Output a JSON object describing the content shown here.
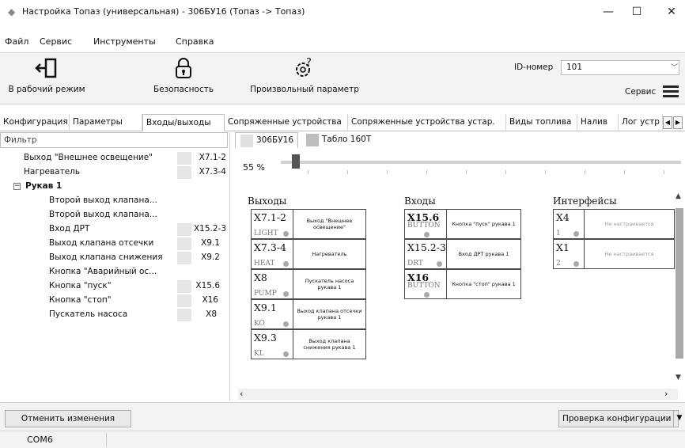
{
  "window": {
    "title": "Настройка Топаз (универсальная) - 306БУ16 (Топаз -> Топаз)",
    "minimize": "—",
    "maximize": "☐",
    "close": "✕"
  },
  "menu": [
    "Файл",
    "Сервис",
    "Инструменты",
    "Справка"
  ],
  "toolbar": {
    "work_mode": "В рабочий режим",
    "security": "Безопасность",
    "arbitrary_param": "Произвольный параметр",
    "id_label": "ID-номер",
    "id_value": "101",
    "service": "Сервис"
  },
  "main_tabs": [
    "Конфигурация",
    "Параметры",
    "Входы/выходы",
    "Сопряженные устройства",
    "Сопряженные устройства устар.",
    "Виды топлива",
    "Налив",
    "Лог устр"
  ],
  "active_main_tab": "Входы/выходы",
  "left_panel": {
    "filter_placeholder": "Фильтр",
    "items": [
      {
        "label": "Выход \"Внешнее освещение\"",
        "pin": "X7.1-2",
        "level": 1
      },
      {
        "label": "Нагреватель",
        "pin": "X7.3-4",
        "level": 1
      },
      {
        "label": "Рукав 1",
        "pin": "",
        "level": 0,
        "group": true
      },
      {
        "label": "Второй выход клапана...",
        "pin": "",
        "level": 2
      },
      {
        "label": "Второй выход клапана...",
        "pin": "",
        "level": 2
      },
      {
        "label": "Вход ДРТ",
        "pin": "X15.2-3",
        "level": 2
      },
      {
        "label": "Выход клапана отсечки",
        "pin": "X9.1",
        "level": 2
      },
      {
        "label": "Выход клапана снижения",
        "pin": "X9.2",
        "level": 2
      },
      {
        "label": "Кнопка \"Аварийный ос...",
        "pin": "",
        "level": 2
      },
      {
        "label": "Кнопка \"пуск\"",
        "pin": "X15.6",
        "level": 2
      },
      {
        "label": "Кнопка \"стоп\"",
        "pin": "X16",
        "level": 2
      },
      {
        "label": "Пускатель насоса",
        "pin": "X8",
        "level": 2
      }
    ]
  },
  "sub_tabs": [
    "306БУ16",
    "Табло 160Т"
  ],
  "zoom": {
    "label": "55 %",
    "value": 55
  },
  "diagram": {
    "outputs_title": "Выходы",
    "inputs_title": "Входы",
    "interfaces_title": "Интерфейсы",
    "outputs": [
      {
        "code": "X7.1-2",
        "sub": "LIGHT",
        "desc": "Выход \"Внешнее освещение\""
      },
      {
        "code": "X7.3-4",
        "sub": "HEAT",
        "desc": "Нагреватель"
      },
      {
        "code": "X8",
        "sub": "PUMP",
        "desc": "Пускатель насоса рукава 1"
      },
      {
        "code": "X9.1",
        "sub": "KO",
        "desc": "Выход клапана отсечки рукава 1"
      },
      {
        "code": "X9.3",
        "sub": "KL",
        "desc": "Выход клапана снижения рукава 1"
      }
    ],
    "inputs": [
      {
        "code": "X15.6",
        "sub": "BUTTON",
        "desc": "Кнопка \"пуск\" рукава 1"
      },
      {
        "code": "X15.2-3",
        "sub": "DRT",
        "desc": "Вход ДРТ рукава 1"
      },
      {
        "code": "X16",
        "sub": "BUTTON",
        "desc": "Кнопка \"стоп\" рукава 1"
      }
    ],
    "interfaces": [
      {
        "code": "X4",
        "sub": "1",
        "desc": "Не настраивается"
      },
      {
        "code": "X1",
        "sub": "2",
        "desc": "Не настраивается"
      }
    ]
  },
  "bottom": {
    "cancel": "Отменить изменения",
    "check": "Проверка конфигурации"
  },
  "status": {
    "port": "COM6"
  }
}
